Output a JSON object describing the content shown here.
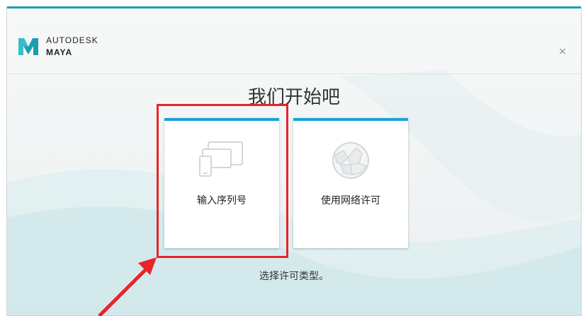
{
  "app": {
    "brand_line1": "AUTODESK",
    "brand_line2": "MAYA",
    "close_symbol": "×"
  },
  "main": {
    "title": "我们开始吧",
    "subtitle": "选择许可类型。",
    "options": [
      {
        "label": "输入序列号",
        "icon": "devices-icon"
      },
      {
        "label": "使用网络许可",
        "icon": "network-globe-icon"
      }
    ]
  },
  "colors": {
    "accent": "#1aa1d6",
    "teal": "#1aa1b3",
    "annotation": "#e8232a"
  }
}
